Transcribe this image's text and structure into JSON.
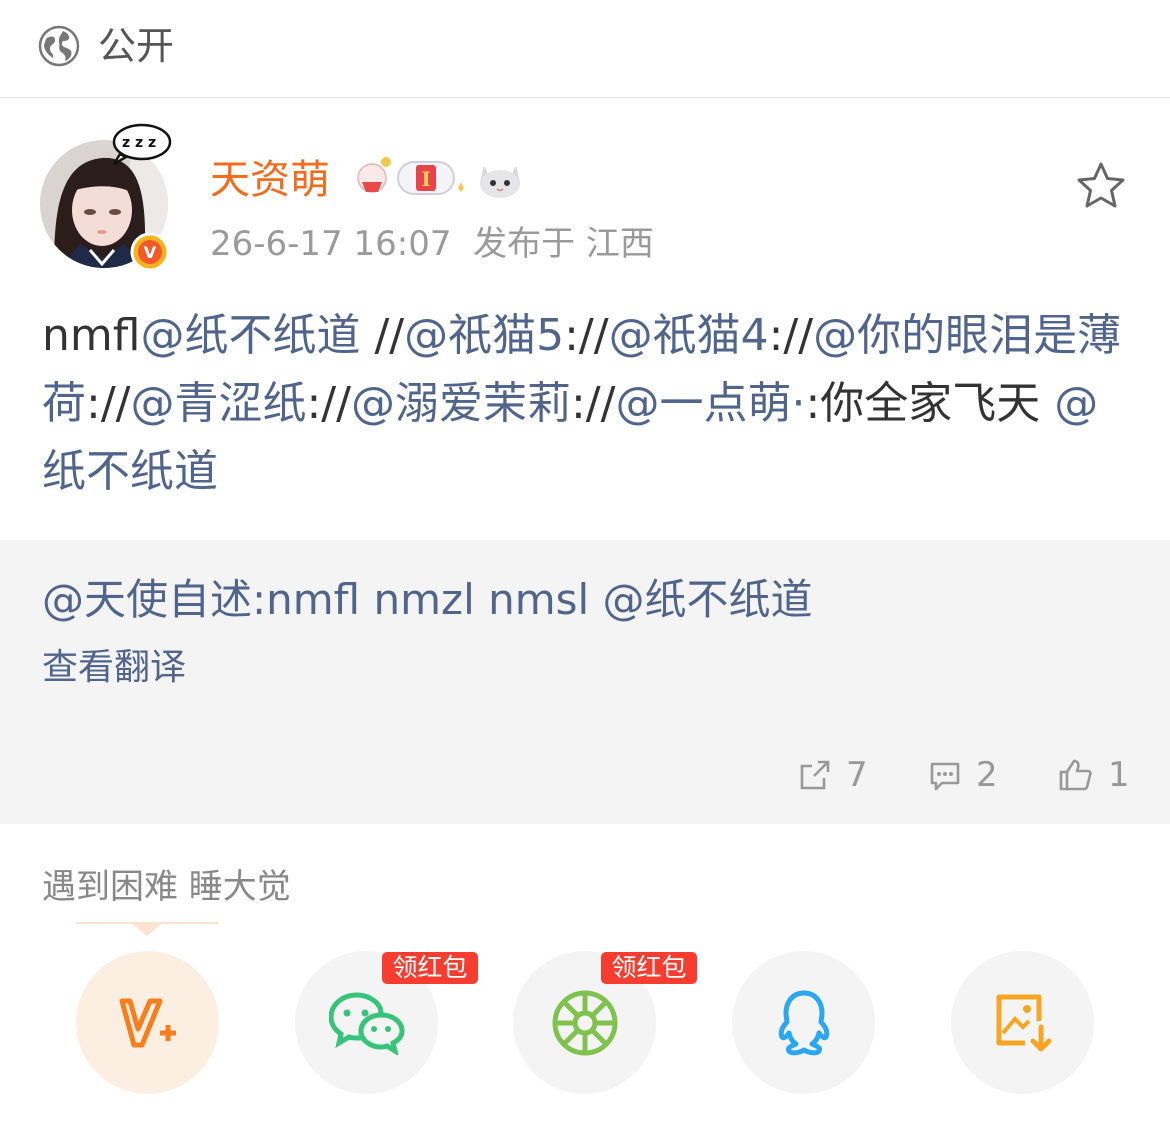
{
  "visibility": {
    "icon": "globe-icon",
    "label": "公开"
  },
  "author": {
    "name": "天资萌",
    "avatar_icon": "sleeping-girl-avatar",
    "verified_badge": "V",
    "badges": [
      "holiday-badge",
      "level-i-badge",
      "cat-badge"
    ],
    "level_badge_text": "I"
  },
  "meta": {
    "time": "26-6-17 16:07",
    "location": "发布于 江西"
  },
  "actions": {
    "favorite_icon": "star-outline-icon"
  },
  "post": {
    "segments": [
      {
        "text": "nmfl",
        "type": "plain"
      },
      {
        "text": "@纸不纸道",
        "type": "mention"
      },
      {
        "text": " //",
        "type": "plain"
      },
      {
        "text": "@祇猫5",
        "type": "mention"
      },
      {
        "text": "://",
        "type": "plain"
      },
      {
        "text": "@祇猫4",
        "type": "mention"
      },
      {
        "text": "://",
        "type": "plain"
      },
      {
        "text": "@你的眼泪是薄荷",
        "type": "mention"
      },
      {
        "text": "://",
        "type": "plain"
      },
      {
        "text": "@青涩纸",
        "type": "mention"
      },
      {
        "text": "://",
        "type": "plain"
      },
      {
        "text": "@溺爱茉莉",
        "type": "mention"
      },
      {
        "text": "://",
        "type": "plain"
      },
      {
        "text": "@一点萌·",
        "type": "mention"
      },
      {
        "text": ":你全家飞天 ",
        "type": "plain"
      },
      {
        "text": "@纸不纸道",
        "type": "mention"
      }
    ]
  },
  "quote": {
    "text": "@天使自述:nmfl nmzl nmsl @纸不纸道",
    "translate_label": "查看翻译"
  },
  "stats": {
    "repost": {
      "icon": "repost-icon",
      "count": "7"
    },
    "comment": {
      "icon": "comment-icon",
      "count": "2"
    },
    "like": {
      "icon": "thumbs-up-icon",
      "count": "1"
    }
  },
  "signature": "遇到困难 睡大觉",
  "share_bar": {
    "items": [
      {
        "icon": "weibo-v-plus-icon",
        "color": "#f57f1f",
        "tag": ""
      },
      {
        "icon": "wechat-icon",
        "color": "#38c37b",
        "tag": "领红包"
      },
      {
        "icon": "moments-icon",
        "color": "#7fc24e",
        "tag": "领红包"
      },
      {
        "icon": "qq-icon",
        "color": "#2aa7ef",
        "tag": ""
      },
      {
        "icon": "save-image-icon",
        "color": "#f6a623",
        "tag": ""
      }
    ]
  },
  "colors": {
    "username": "#f36b1b",
    "mention": "#50648c",
    "red_tag": "#f63d2f"
  }
}
